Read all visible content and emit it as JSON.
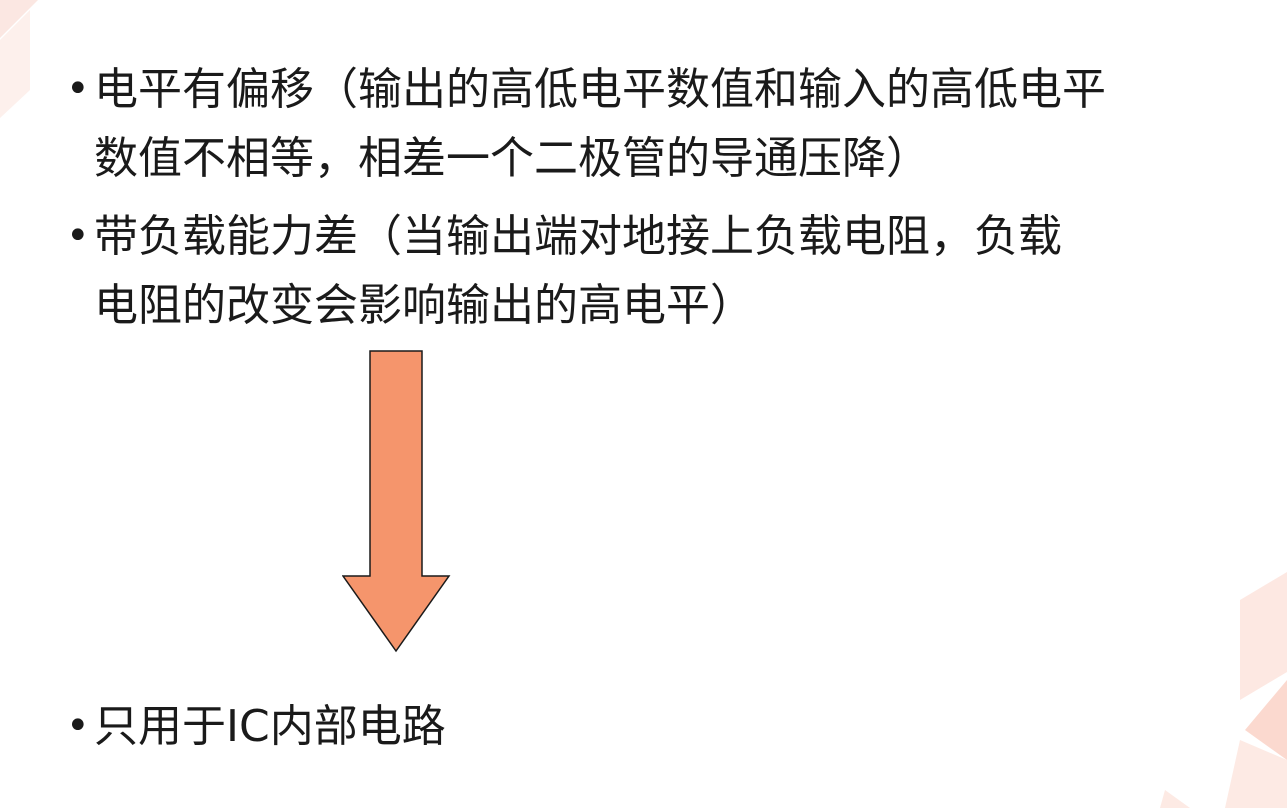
{
  "slide": {
    "bullets": [
      {
        "lines": [
          "电平有偏移（输出的高低电平数值和输入的高低电平",
          "数值不相等，相差一个二极管的导通压降）"
        ]
      },
      {
        "lines": [
          "带负载能力差（当输出端对地接上负载电阻，负载",
          "电阻的改变会影响输出的高电平）"
        ]
      },
      {
        "lines": [
          "只用于IC内部电路"
        ]
      }
    ],
    "bullet_symbol": "•",
    "arrow": {
      "direction": "down",
      "fill": "#f5956c",
      "stroke": "#1a1a1a"
    },
    "decoration": {
      "color": "#fbe4de"
    }
  }
}
